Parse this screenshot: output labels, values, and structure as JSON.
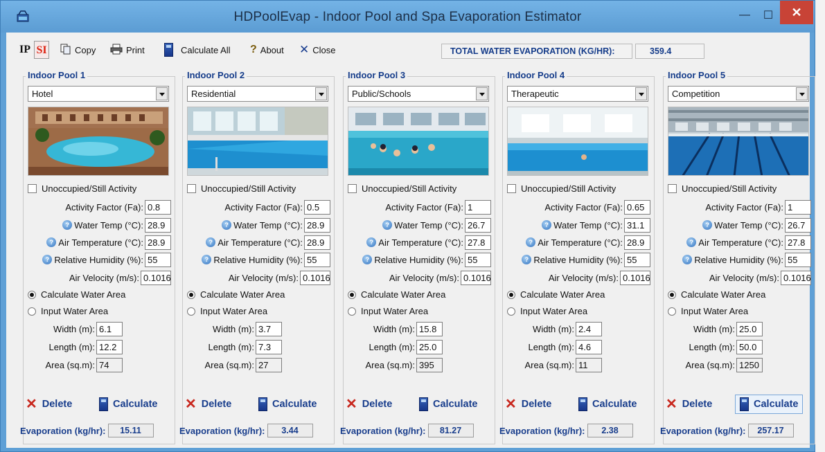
{
  "window": {
    "title": "HDPoolEvap - Indoor Pool and Spa Evaporation Estimator",
    "controls": {
      "minimize": "—",
      "maximize": "☐",
      "close": "✕"
    }
  },
  "toolbar": {
    "ip": "IP",
    "si": "SI",
    "copy": "Copy",
    "print": "Print",
    "calculate_all": "Calculate All",
    "about": "About",
    "close": "Close",
    "total_label": "TOTAL WATER EVAPORATION (KG/HR):",
    "total_value": "359.4"
  },
  "labels": {
    "unoccupied": "Unoccupied/Still Activity",
    "activity_factor": "Activity Factor (Fa):",
    "water_temp": "Water Temp (°C):",
    "air_temp": "Air Temperature (°C):",
    "humidity": "Relative Humidity (%):",
    "air_velocity": "Air Velocity (m/s):",
    "calc_area": "Calculate Water Area",
    "input_area": "Input Water Area",
    "width": "Width (m):",
    "length": "Length (m):",
    "area": "Area (sq.m):",
    "delete": "Delete",
    "calculate": "Calculate",
    "evaporation": "Evaporation (kg/hr):"
  },
  "pools": [
    {
      "title": "Indoor Pool 1",
      "type": "Hotel",
      "activity": "0.8",
      "water_temp": "28.9",
      "air_temp": "28.9",
      "humidity": "55",
      "air_velocity": "0.1016",
      "width": "6.1",
      "length": "12.2",
      "area": "74",
      "evaporation": "15.11"
    },
    {
      "title": "Indoor Pool 2",
      "type": "Residential",
      "activity": "0.5",
      "water_temp": "28.9",
      "air_temp": "28.9",
      "humidity": "55",
      "air_velocity": "0.1016",
      "width": "3.7",
      "length": "7.3",
      "area": "27",
      "evaporation": "3.44"
    },
    {
      "title": "Indoor Pool 3",
      "type": "Public/Schools",
      "activity": "1",
      "water_temp": "26.7",
      "air_temp": "27.8",
      "humidity": "55",
      "air_velocity": "0.1016",
      "width": "15.8",
      "length": "25.0",
      "area": "395",
      "evaporation": "81.27"
    },
    {
      "title": "Indoor Pool 4",
      "type": "Therapeutic",
      "activity": "0.65",
      "water_temp": "31.1",
      "air_temp": "28.9",
      "humidity": "55",
      "air_velocity": "0.1016",
      "width": "2.4",
      "length": "4.6",
      "area": "11",
      "evaporation": "2.38"
    },
    {
      "title": "Indoor Pool 5",
      "type": "Competition",
      "activity": "1",
      "water_temp": "26.7",
      "air_temp": "27.8",
      "humidity": "55",
      "air_velocity": "0.1016",
      "width": "25.0",
      "length": "50.0",
      "area": "1250",
      "evaporation": "257.17"
    }
  ],
  "colors": {
    "titlebar": "#5fa0d6",
    "close_button": "#c84336",
    "label_blue": "#153c8a",
    "delete_red": "#c8271d"
  }
}
